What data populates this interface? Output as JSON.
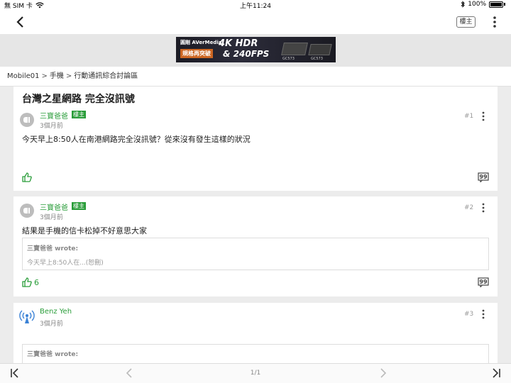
{
  "status_bar": {
    "carrier": "無 SIM 卡",
    "time": "上午11:24",
    "battery": "100%"
  },
  "navbar": {
    "owner_chip": "樓主"
  },
  "ad": {
    "brand": "圓剛 AVerMedia",
    "tag": "規格再突破",
    "headline": "4K HDR",
    "sub": "& 240FPS",
    "model1": "GC573",
    "model2": "GC573"
  },
  "breadcrumb": {
    "items": [
      "Mobile01",
      "手機",
      "行動通訊綜合討論區"
    ],
    "separator": ">"
  },
  "thread": {
    "title": "台灣之星網路 完全沒訊號"
  },
  "posts": [
    {
      "author": "三寶爸爸",
      "badge": "樓主",
      "time": "3個月前",
      "floor": "#1",
      "body": "今天早上8:50人在南港網路完全沒訊號？從來沒有發生這樣的狀況",
      "likes": ""
    },
    {
      "author": "三寶爸爸",
      "badge": "樓主",
      "time": "3個月前",
      "floor": "#2",
      "body": "結果是手機的信卡松掉不好意思大家",
      "likes": "6",
      "quote": {
        "author": "三寶爸爸 wrote:",
        "text": "今天早上8:50人在...(恕刪)"
      }
    },
    {
      "author": "Benz Yeh",
      "badge": "",
      "time": "3個月前",
      "floor": "#3",
      "quote": {
        "author": "三寶爸爸 wrote:"
      }
    }
  ],
  "pager": {
    "indicator": "1/1"
  },
  "colors": {
    "green": "#2a9d3a",
    "bg": "#ececec"
  }
}
